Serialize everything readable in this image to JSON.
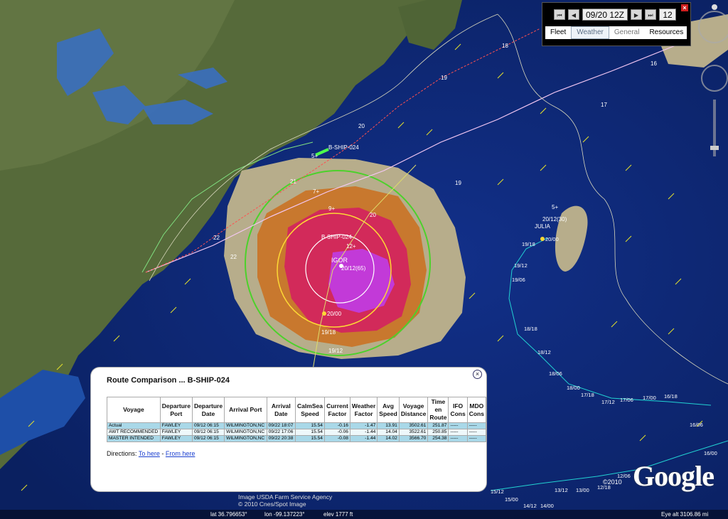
{
  "time_control": {
    "date_time": "09/20 12Z",
    "step_hours": "12",
    "tabs": [
      {
        "label": "Fleet"
      },
      {
        "label": "Weather"
      },
      {
        "label": "General"
      },
      {
        "label": "Resources"
      }
    ]
  },
  "map_labels": {
    "ship_name": "B-SHIP-024",
    "storm_name": "IGOR",
    "storm_time": "20/12(65)",
    "storm_2_name": "JULIA",
    "storm_2_time": "20/12(30)",
    "route_marks": [
      "18",
      "19",
      "20",
      "21",
      "22",
      "17",
      "16"
    ],
    "track_times_igor": [
      "20/00",
      "19/18",
      "19/12"
    ],
    "track_times_julia": [
      "20/00",
      "19/18",
      "19/12",
      "19/06",
      "18/18",
      "18/12",
      "18/06",
      "18/00",
      "17/18",
      "17/12",
      "17/06",
      "17/00",
      "16/18",
      "16/06",
      "16/00",
      "15/12",
      "15/00",
      "14/12",
      "14/00",
      "13/12",
      "13/00",
      "12/18",
      "12/06"
    ],
    "wind_radii": [
      "5+",
      "7+",
      "9+",
      "12+"
    ]
  },
  "popup": {
    "title": "Route Comparison ... B-SHIP-024",
    "columns": [
      "Voyage",
      "Departure Port",
      "Departure Date",
      "Arrival Port",
      "Arrival Date",
      "CalmSea Speed",
      "Current Factor",
      "Weather Factor",
      "Avg Speed",
      "Voyage Distance",
      "Time en Route",
      "IFO Cons",
      "MDO Cons"
    ],
    "rows": [
      [
        "Actual",
        "FAWLEY",
        "09/12 06:15",
        "WILMINGTON,NC",
        "09/22 18:07",
        "15.54",
        "-0.16",
        "-1.47",
        "13.91",
        "3502.61",
        "251.87",
        "-----",
        "-----"
      ],
      [
        "AWT RECOMMENDED",
        "FAWLEY",
        "09/12 06:15",
        "WILMINGTON,NC",
        "09/22 17:06",
        "15.54",
        "-0.06",
        "-1.44",
        "14.04",
        "3522.61",
        "250.85",
        "-----",
        "-----"
      ],
      [
        "MASTER INTENDED",
        "FAWLEY",
        "09/12 06:15",
        "WILMINGTON,NC",
        "09/22 20:38",
        "15.54",
        "-0.08",
        "-1.44",
        "14.02",
        "3566.70",
        "254.38",
        "-----",
        "-----"
      ]
    ],
    "directions_label": "Directions:",
    "to_here": "To here",
    "separator": " - ",
    "from_here": "From here"
  },
  "attribution": {
    "line1": "Image USDA Farm Service Agency",
    "line2": "© 2010 Cnes/Spot Image"
  },
  "status_bar": {
    "lat": "lat   36.796653°",
    "lon": "lon  -99.137223°",
    "elev": "elev  1777 ft",
    "eye_alt": "Eye alt  3106.86 mi"
  },
  "google": {
    "logo": "Google",
    "copyright": "©2010"
  },
  "colors": {
    "ocean": "#0d2a6e",
    "land": "#5b6b3e",
    "hazard_outer": "#b8ad8c",
    "hazard_mid": "#c8782e",
    "hazard_inner": "#d22a5a",
    "hazard_core": "#c23ad8",
    "table_row_highlight": "#a9d8e8"
  }
}
